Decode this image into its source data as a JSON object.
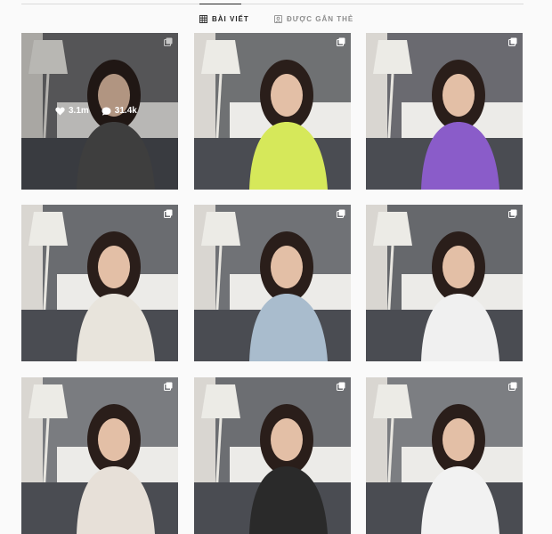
{
  "tabs": [
    {
      "label": "BÀI VIẾT",
      "icon": "grid-icon",
      "active": true
    },
    {
      "label": "ĐƯỢC GẮN THẺ",
      "icon": "tag-icon",
      "active": false
    }
  ],
  "posts": [
    {
      "likes": "3.1m",
      "comments": "31.4k",
      "multiple": true,
      "hovered": true,
      "shirt": "#505050",
      "wall": "#6e6e70"
    },
    {
      "multiple": true,
      "shirt": "#d6e85a",
      "wall": "#6f7173"
    },
    {
      "multiple": true,
      "shirt": "#8a5cc9",
      "wall": "#6a6a70"
    },
    {
      "multiple": true,
      "shirt": "#e8e4dc",
      "wall": "#6a6c70"
    },
    {
      "multiple": true,
      "shirt": "#a9bccd",
      "wall": "#707276"
    },
    {
      "multiple": true,
      "shirt": "#f0f0f0",
      "wall": "#66686c"
    },
    {
      "multiple": true,
      "shirt": "#e7e0d8",
      "wall": "#7a7c80"
    },
    {
      "multiple": true,
      "shirt": "#2a2a2a",
      "wall": "#6c6e72"
    },
    {
      "multiple": true,
      "shirt": "#f2f2f2",
      "wall": "#7c7e82"
    }
  ],
  "colors": {
    "accent": "#262626",
    "muted": "#8e8e8e",
    "divider": "#dbdbdb",
    "background": "#fafafa"
  }
}
